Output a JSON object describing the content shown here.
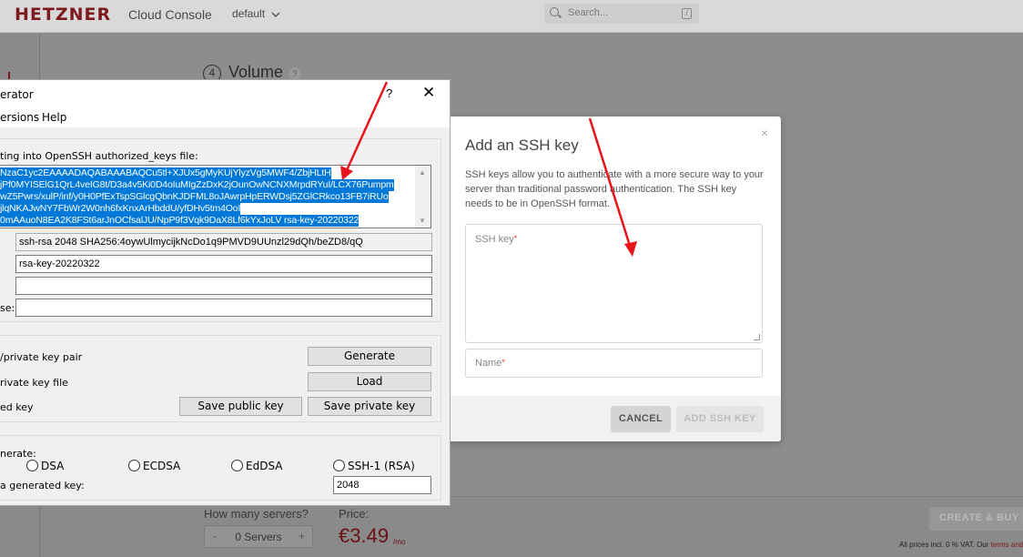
{
  "console": {
    "logo": "HETZNER",
    "title": "Cloud Console",
    "project": "default",
    "search_placeholder": "Search...",
    "search_shortcut": "/",
    "volume_step": "4",
    "volume_title": "Volume",
    "volume_help": "?",
    "servers_label": "How many servers?",
    "servers_minus": "-",
    "servers_plus": "+",
    "servers_value": "0 Servers",
    "price_label": "Price:",
    "price_value": "€3.49",
    "price_unit": "/mo",
    "buy_button": "CREATE & BUY NOW",
    "vat_note": "All prices incl. 0 % VAT. Our",
    "vat_terms": "terms and"
  },
  "modal": {
    "close": "×",
    "title": "Add an SSH key",
    "description": "SSH keys allow you to authenticate with a more secure way to your server than traditional password authentication. The SSH key needs to be in OpenSSH format.",
    "ssh_key_label": "SSH key",
    "name_label": "Name",
    "required_mark": "*",
    "cancel": "CANCEL",
    "add": "ADD SSH KEY"
  },
  "putty": {
    "title": "erator",
    "help": "?",
    "close": "✕",
    "menu": [
      "ersions",
      "Help"
    ],
    "key_label": "ting into OpenSSH authorized_keys file:",
    "key_lines": [
      "NzaC1yc2EAAAADAQABAAABAQCu5tl+XJUx5gMyKUjYlyzVg5MWF4/ZbjHLtH",
      "jPf0MYISElG1QrL4veIG8t/D3a4v5Ki0D4oIuMIgZzDxK2jOunOwNCNXMrpdRYuI/LCX76Pumpm",
      "wZ5Pwrs/xulP/inf/y0H0PfExTspSGlcgQbnKJDFML8oJAwrpHpERWDsj5ZGlCRkco13FB7iRUo",
      "jlqNKAJwNY7FbWr2W0nh6fxKnxArHbddU/yfDHv5tm4OoI",
      "0mAAuoN8EA2K8FSt6arJnOCfsalJU/NpP9f3Vqk9DaX8Lf6kYxJoLV rsa-key-20220322"
    ],
    "fingerprint": "ssh-rsa 2048 SHA256:4oywUlmycijkNcDo1q9PMVD9UUnzl29dQh/beZD8/qQ",
    "comment": "rsa-key-20220322",
    "passphrase": "",
    "confirm_label": "se:",
    "confirm": "",
    "generate_label": "/private key pair",
    "generate_button": "Generate",
    "load_label": "rivate key file",
    "load_button": "Load",
    "save_label": "ed key",
    "save_public_button": "Save public key",
    "save_private_button": "Save private key",
    "type_label": "nerate:",
    "key_types": [
      "DSA",
      "ECDSA",
      "EdDSA",
      "SSH-1 (RSA)"
    ],
    "bits_label": "a generated key:",
    "bits_value": "2048"
  }
}
